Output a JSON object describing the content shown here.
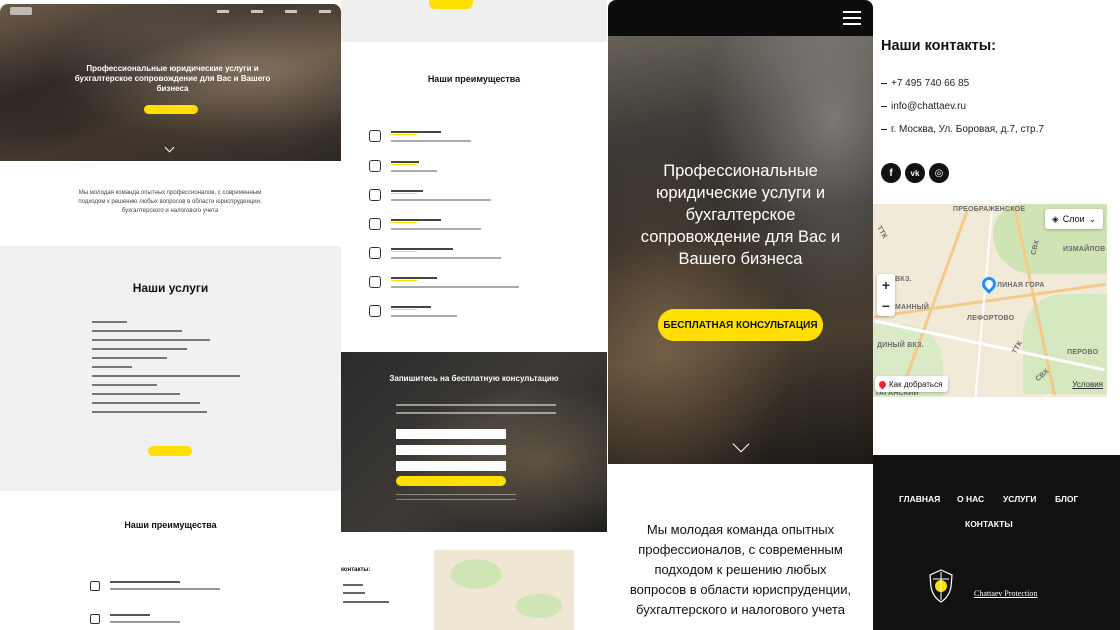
{
  "colors": {
    "accent": "#ffdf00",
    "dark": "#111111",
    "light_section": "#f1f1f1",
    "map_pin": "#1e90ff"
  },
  "mobile": {
    "hero_title": "Профессиональные юридические услуги и бухгалтерское сопровождение для Вас и Вашего бизнеса",
    "cta_label": "БЕСПЛАТНАЯ КОНСУЛЬТАЦИЯ",
    "about_text": "Мы молодая команда опытных профессионалов, с современным подходом к решению любых вопросов в области юриспруденции, бухгалтерского и налогового учета",
    "menu_icon": "hamburger-icon"
  },
  "desktop": {
    "hero_title": "Профессиональные юридические услуги и бухгалтерское сопровождение для Вас и Вашего бизнеса",
    "about_text": "Мы молодая команда опытных профессионалов, с современным подходом к решению любых вопросов в области юриспруденции, бухгалтерского и налогового учета",
    "services_title": "Наши услуги",
    "advantages_title": "Наши преимущества"
  },
  "panel2": {
    "advantages_title": "Наши преимущества",
    "form_title": "Запишитесь на бесплатную консультацию",
    "contacts_label": "контакты:"
  },
  "contacts": {
    "title": "Наши контакты:",
    "phone": "+7 495 740 66 85",
    "email": "info@chattaev.ru",
    "address": "г. Москва, Ул. Боровая, д.7, стр.7",
    "socials": [
      {
        "label": "f",
        "icon": "facebook-icon"
      },
      {
        "label": "vk",
        "icon": "vk-icon"
      },
      {
        "label": "◎",
        "icon": "instagram-icon"
      }
    ]
  },
  "map": {
    "layers_label": "Слои",
    "route_label": "Как добраться",
    "terms_label": "Условия",
    "labels": [
      "ПРЕОБРАЖЕНСКОЕ",
      "ИЗМАЙЛОВ",
      "ВКЗ.",
      "МАННЫЙ",
      "ЛИНАЯ ГОРА",
      "ЛЕФОРТОВО",
      "ДИНЫЙ ВКЗ.",
      "ПЕРОВО",
      "ТАГАНСКИЙ",
      "ТТК",
      "СВХ",
      "ТТК",
      "СВХ"
    ]
  },
  "footer": {
    "nav": [
      "ГЛАВНАЯ",
      "О НАС",
      "УСЛУГИ",
      "БЛОГ",
      "КОНТАКТЫ"
    ],
    "brand": "Chattaev Protection"
  }
}
